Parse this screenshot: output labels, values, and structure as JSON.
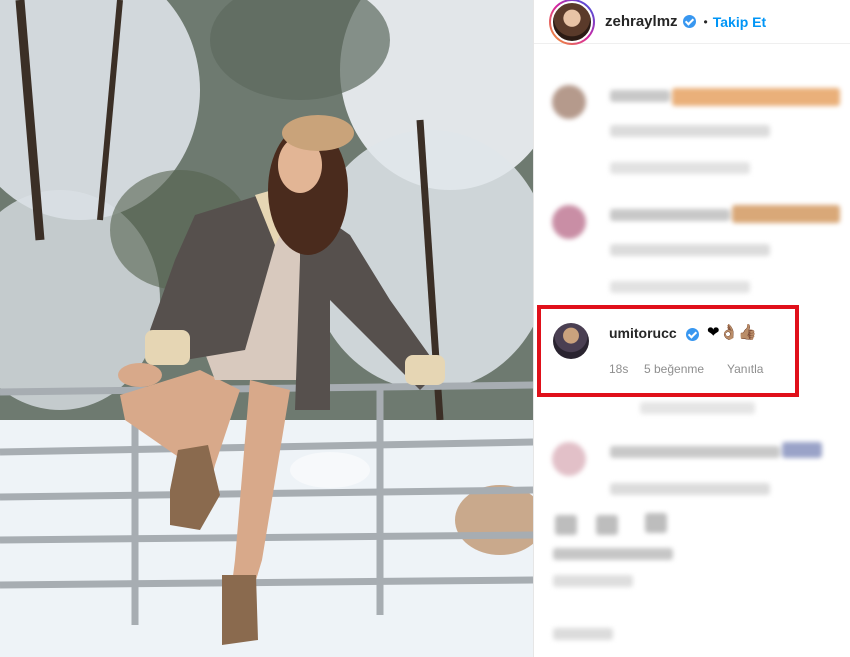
{
  "post": {
    "username": "zehraylmz",
    "separator": "•",
    "follow_label": "Takip Et"
  },
  "highlighted_comment": {
    "username": "umitorucc",
    "emojis": "❤👌🏽👍🏽",
    "time": "18s",
    "likes": "5 beğenme",
    "reply_label": "Yanıtla",
    "highlight_color": "#e0101a"
  },
  "colors": {
    "accent": "#0095f6",
    "verified": "#3897f0",
    "meta_text": "#8e8e8e"
  }
}
